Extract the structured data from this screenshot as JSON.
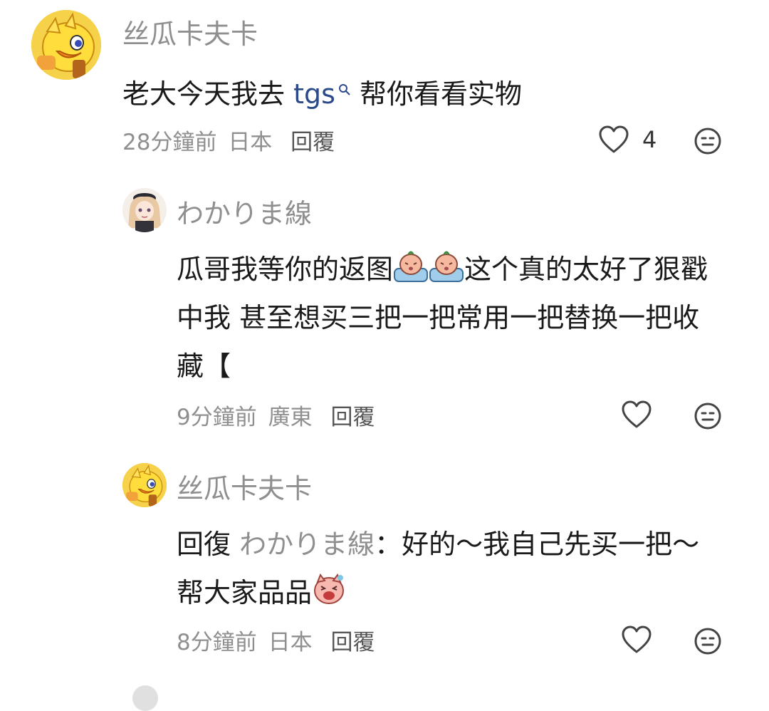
{
  "comments": [
    {
      "username": "丝瓜卡夫卡",
      "text_before": "老大今天我去 ",
      "tag": "tgs",
      "text_after": " 帮你看看实物",
      "time": "28分鐘前",
      "location": "日本",
      "reply_label": "回覆",
      "like_count": "4",
      "avatar_icon": "duck-avatar-icon"
    },
    {
      "username": "わかりま線",
      "line1_before": "瓜哥我等你的返图",
      "line1_after": "这个真的太好了狠戳",
      "line2": "中我 甚至想买三把一把常用一把替换一把收",
      "line3": "藏【",
      "time": "9分鐘前",
      "location": "廣東",
      "reply_label": "回覆",
      "avatar_icon": "anime-girl-avatar-icon"
    },
    {
      "username": "丝瓜卡夫卡",
      "reply_prefix": "回復",
      "reply_to": "わかりま線",
      "line1_after": "：好的～我自己先买一把～",
      "line2": "帮大家品品",
      "time": "8分鐘前",
      "location": "日本",
      "reply_label": "回覆",
      "avatar_icon": "duck-avatar-icon"
    }
  ],
  "colors": {
    "muted": "#8f8f8f",
    "link": "#2a4a8a",
    "text": "#1a1a1a"
  }
}
